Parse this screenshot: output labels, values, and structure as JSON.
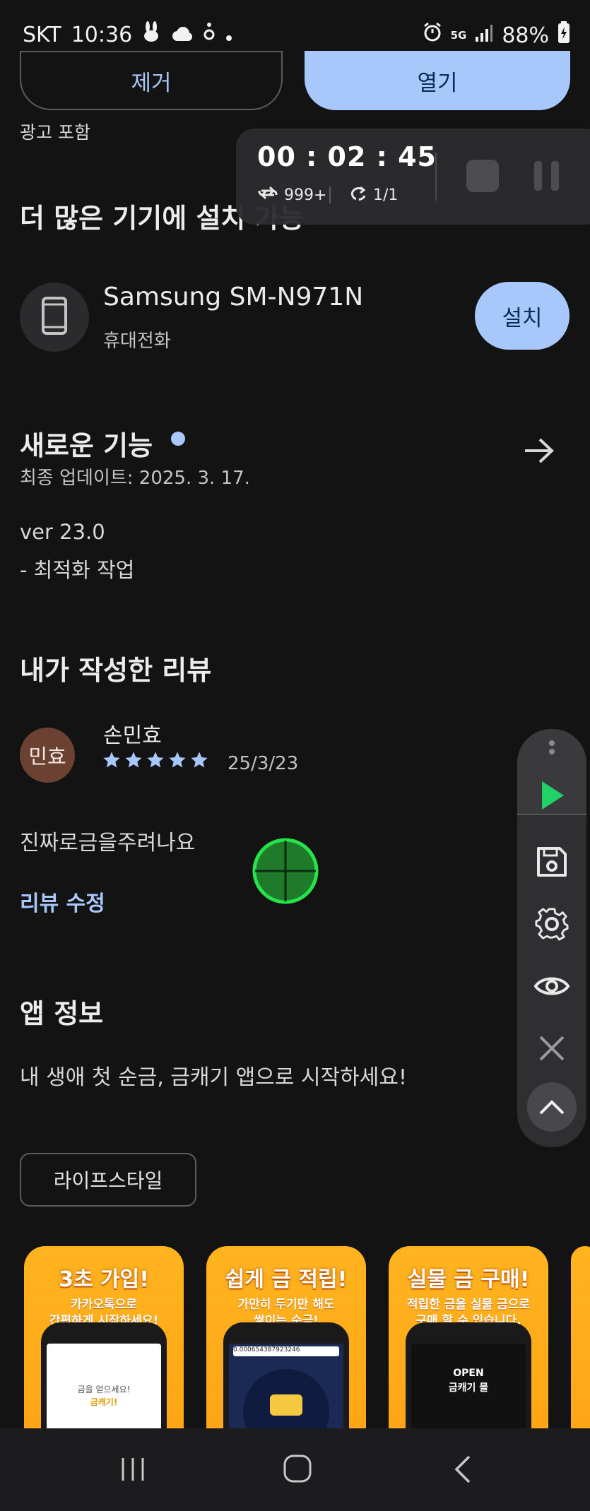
{
  "status_bar": {
    "carrier": "SKT",
    "time": "10:36",
    "network": "5G",
    "battery": "88%"
  },
  "top_actions": {
    "remove_label": "제거",
    "open_label": "열기",
    "ads_notice": "광고 포함"
  },
  "recorder": {
    "timer": "00 : 02 : 45",
    "loop_count": "999+",
    "repeat_count": "1/1"
  },
  "more_devices": {
    "title": "더 많은 기기에 설치 가능",
    "device_name": "Samsung SM-N971N",
    "device_type": "휴대전화",
    "install_label": "설치"
  },
  "whats_new": {
    "title": "새로운 기능",
    "updated": "최종 업데이트: 2025. 3. 17.",
    "version": "ver 23.0",
    "note": "- 최적화 작업"
  },
  "my_review": {
    "title": "내가 작성한 리뷰",
    "avatar_text": "민효",
    "author": "손민효",
    "rating": 5,
    "date": "25/3/23",
    "body": "진짜로금을주려나요",
    "edit_label": "리뷰 수정"
  },
  "app_info": {
    "title": "앱 정보",
    "description": "내 생애 첫 순금, 금캐기 앱으로 시작하세요!",
    "category_chip": "라이프스타일"
  },
  "screenshots": [
    {
      "title": "3초 가입!",
      "line1": "카카오톡으로",
      "line2": "간편하게 시작하세요!",
      "screen_line1": "금을 얻으세요!",
      "screen_line2": "금캐기!"
    },
    {
      "title": "쉽게 금 적립!",
      "line1": "가만히 두기만 해도",
      "line2": "쌓이는 순금!",
      "screen_line1": "0.000654387923246",
      "screen_line2": ""
    },
    {
      "title": "실물 금 구매!",
      "line1": "적립한 금을 실물 금으로",
      "line2": "구매 할 수 있습니다.",
      "screen_line1": "OPEN",
      "screen_line2": "금캐기 몰"
    }
  ],
  "colors": {
    "background": "#131314",
    "accent": "#a8c7fa",
    "star": "#a8c7fa",
    "link": "#a8c7fa",
    "play_green": "#21d366"
  }
}
